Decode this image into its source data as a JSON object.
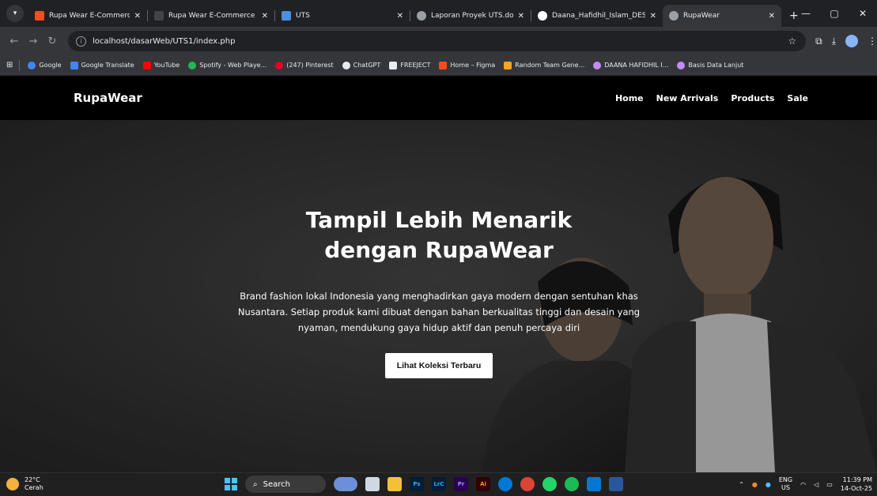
{
  "browser": {
    "tabs": [
      {
        "label": "Rupa Wear E-Commerce -",
        "favicon_color": "#f24e1e",
        "active": false
      },
      {
        "label": "Rupa Wear E-Commerce",
        "favicon_color": "#555555",
        "active": false
      },
      {
        "label": "UTS",
        "favicon_color": "#4a90e2",
        "active": false
      },
      {
        "label": "Laporan Proyek UTS.docx",
        "favicon_color": "#9aa0a6",
        "active": false
      },
      {
        "label": "Daana_Hafidhil_Islam_DESI",
        "favicon_color": "#ffffff",
        "active": false
      },
      {
        "label": "RupaWear",
        "favicon_color": "#9aa0a6",
        "active": true
      }
    ],
    "url": "localhost/dasarWeb/UTS1/index.php",
    "bookmarks": [
      {
        "label": "Google",
        "color": "#4285f4"
      },
      {
        "label": "Google Translate",
        "color": "#4285f4"
      },
      {
        "label": "YouTube",
        "color": "#ff0000"
      },
      {
        "label": "Spotify - Web Playe...",
        "color": "#1db954"
      },
      {
        "label": "(247) Pinterest",
        "color": "#e60023"
      },
      {
        "label": "ChatGPT",
        "color": "#e8eaed"
      },
      {
        "label": "FREEJECT",
        "color": "#e8eaed"
      },
      {
        "label": "Home – Figma",
        "color": "#f24e1e"
      },
      {
        "label": "Random Team Gene...",
        "color": "#f5a623"
      },
      {
        "label": "DAANA HAFIDHIL I...",
        "color": "#c58af9"
      },
      {
        "label": "Basis Data Lanjut",
        "color": "#c58af9"
      }
    ]
  },
  "site": {
    "brand": "RupaWear",
    "nav": [
      "Home",
      "New Arrivals",
      "Products",
      "Sale"
    ],
    "hero": {
      "title_line1": "Tampil Lebih Menarik",
      "title_line2": "dengan RupaWear",
      "description": "Brand fashion lokal Indonesia yang menghadirkan gaya modern dengan sentuhan khas Nusantara. Setiap produk kami dibuat dengan bahan berkualitas tinggi dan desain yang nyaman, mendukung gaya hidup aktif dan penuh percaya diri",
      "cta_label": "Lihat Koleksi Terbaru"
    }
  },
  "taskbar": {
    "temperature": "22°C",
    "weather": "Cerah",
    "search_label": "Search",
    "lang_line1": "ENG",
    "lang_line2": "US",
    "time": "11:39 PM",
    "date": "14-Oct-25"
  }
}
